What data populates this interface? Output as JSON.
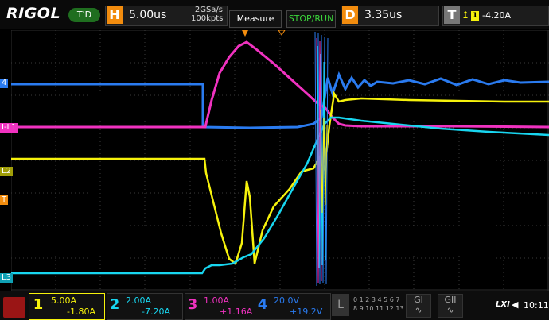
{
  "header": {
    "brand": "RIGOL",
    "trigger_status": "T'D",
    "horizontal_key": "H",
    "timebase": "5.00us",
    "sample_rate": "2GSa/s",
    "memory_depth": "100kpts",
    "measure_label": "Measure",
    "stoprun_label": "STOP/RUN",
    "delay_key": "D",
    "delay_value": "3.35us",
    "trigger_key": "T",
    "trigger_source": "1",
    "trigger_level": "-4.20A"
  },
  "markers": {
    "ch1_label": "L2",
    "ch2_label": "L3",
    "ch3_label": "I-L1",
    "ch4_label": "4",
    "trigger_marker": "T",
    "trigger_top": "T"
  },
  "channels": [
    {
      "num": "1",
      "scale": "5.00A",
      "offset": "-1.80A",
      "color": "#f6f20c"
    },
    {
      "num": "2",
      "scale": "2.00A",
      "offset": "-7.20A",
      "color": "#18d6f0"
    },
    {
      "num": "3",
      "scale": "1.00A",
      "offset": "+1.16A",
      "color": "#f032c0"
    },
    {
      "num": "4",
      "scale": "20.0V",
      "offset": "+19.2V",
      "color": "#2a7bf0"
    }
  ],
  "logic": {
    "key": "L",
    "bits_row1": "0 1 2 3 4 5 6 7",
    "bits_row2": "8 9 10 11 12 13 14 15"
  },
  "generators": [
    "GI",
    "GII"
  ],
  "status": {
    "lxi": "LXI",
    "time": "10:11"
  },
  "colors": {
    "ch1": "#f6f20c",
    "ch2": "#18d6f0",
    "ch3": "#f032c0",
    "ch4": "#2a7bf0",
    "accent": "#f28c0e"
  }
}
